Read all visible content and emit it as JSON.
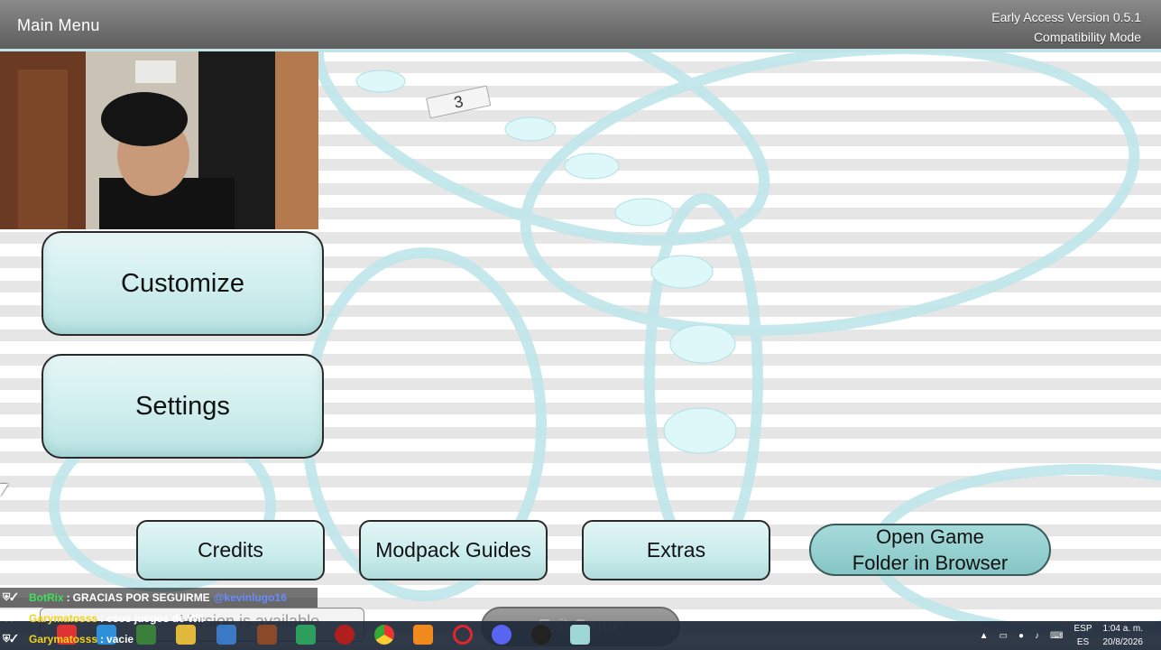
{
  "app": {
    "title": "Main Menu",
    "version_line1": "Early Access Version 0.5.1",
    "version_line2": "Compatibility Mode"
  },
  "menu": {
    "customize": "Customize",
    "settings": "Settings",
    "credits": "Credits",
    "modpack_guides": "Modpack Guides",
    "extras": "Extras",
    "open_folder_line1": "Open Game",
    "open_folder_line2": "Folder in Browser",
    "exit": "Exit Game",
    "update_notice": "Version is available"
  },
  "background": {
    "dice_label": "3"
  },
  "chat": [
    {
      "user": "BotRix",
      "message": "GRACIAS POR SEGUIRME",
      "mention": "@kevinlugo16",
      "user_color": "#3fe05a"
    },
    {
      "user": "Garymatosss",
      "message": "esos juegos de Wii",
      "mention": "",
      "user_color": "#f1d21c"
    },
    {
      "user": "Garymatosss",
      "message": "vacie",
      "mention": "",
      "user_color": "#f1d21c"
    }
  ],
  "taskbar": {
    "lang_top": "ESP",
    "lang_bottom": "ES",
    "time": "1:04 a. m.",
    "date": "20/8/2026"
  },
  "colors": {
    "accent": "#bfe3e6",
    "button_fill": "#cfeeee",
    "pill_fill": "#96d0d0"
  }
}
